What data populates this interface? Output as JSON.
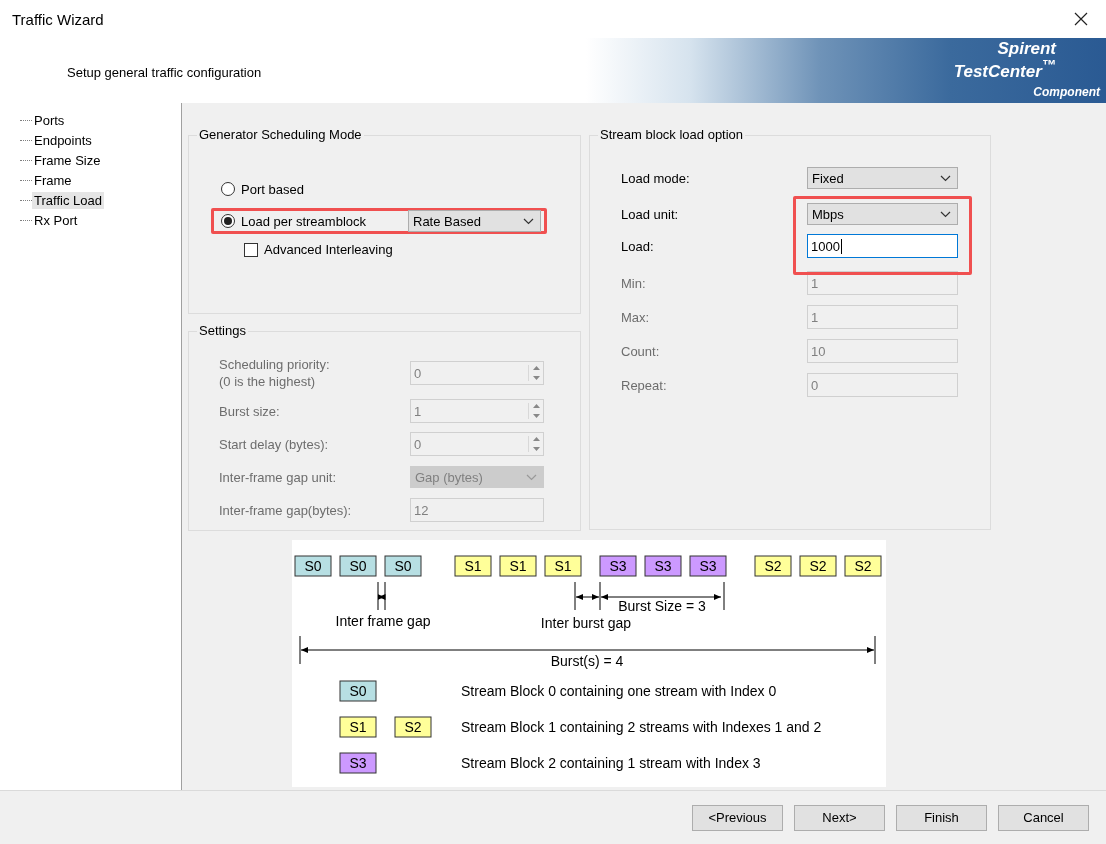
{
  "window": {
    "title": "Traffic Wizard"
  },
  "header": {
    "subtitle": "Setup general traffic configuration",
    "logo": {
      "line1": "Spirent",
      "line2": "TestCenter",
      "mark": "™",
      "tag": "Component"
    }
  },
  "sidebar": {
    "items": [
      {
        "label": "Ports",
        "selected": false
      },
      {
        "label": "Endpoints",
        "selected": false
      },
      {
        "label": "Frame Size",
        "selected": false
      },
      {
        "label": "Frame",
        "selected": false
      },
      {
        "label": "Traffic Load",
        "selected": true
      },
      {
        "label": "Rx Port",
        "selected": false
      }
    ]
  },
  "scheduling": {
    "title": "Generator Scheduling Mode",
    "options": [
      {
        "label": "Port based",
        "selected": false,
        "highlighted": false
      },
      {
        "label": "Load per streamblock",
        "selected": true,
        "highlighted": true,
        "dropdown": "Rate Based"
      }
    ],
    "checkbox": {
      "label": "Advanced Interleaving",
      "checked": false
    }
  },
  "settings": {
    "title": "Settings",
    "rows": [
      {
        "kind": "spinner",
        "label": "Scheduling priority:",
        "hint": "(0 is the highest)",
        "value": "0",
        "disabled": true
      },
      {
        "kind": "spinner",
        "label": "Burst size:",
        "value": "1",
        "disabled": true
      },
      {
        "kind": "spinner",
        "label": "Start delay (bytes):",
        "value": "0",
        "disabled": true
      },
      {
        "kind": "dropdown",
        "label": "Inter-frame gap unit:",
        "value": "Gap (bytes)",
        "disabled": true
      },
      {
        "kind": "input",
        "label": "Inter-frame gap(bytes):",
        "value": "12",
        "disabled": true
      }
    ]
  },
  "load_option": {
    "title": "Stream block load option",
    "rows": [
      {
        "kind": "dropdown",
        "label": "Load mode:",
        "value": "Fixed",
        "disabled": false,
        "highlighted": false
      },
      {
        "kind": "dropdown",
        "label": "Load unit:",
        "value": "Mbps",
        "disabled": false,
        "highlighted": true
      },
      {
        "kind": "input",
        "label": "Load:",
        "value": "1000",
        "disabled": false,
        "highlighted": true,
        "focused": true
      },
      {
        "kind": "input",
        "label": "Min:",
        "value": "1",
        "disabled": true,
        "highlighted": false
      },
      {
        "kind": "input",
        "label": "Max:",
        "value": "1",
        "disabled": true,
        "highlighted": false
      },
      {
        "kind": "input",
        "label": "Count:",
        "value": "10",
        "disabled": true,
        "highlighted": false
      },
      {
        "kind": "input",
        "label": "Repeat:",
        "value": "0",
        "disabled": true,
        "highlighted": false
      }
    ]
  },
  "diagram": {
    "frames": [
      {
        "label": "S0",
        "color": "#b7dfe3"
      },
      {
        "label": "S0",
        "color": "#b7dfe3"
      },
      {
        "label": "S0",
        "color": "#b7dfe3"
      },
      {
        "label": "S1",
        "color": "#ffff99"
      },
      {
        "label": "S1",
        "color": "#ffff99"
      },
      {
        "label": "S1",
        "color": "#ffff99"
      },
      {
        "label": "S3",
        "color": "#cc99ff"
      },
      {
        "label": "S3",
        "color": "#cc99ff"
      },
      {
        "label": "S3",
        "color": "#cc99ff"
      },
      {
        "label": "S2",
        "color": "#ffff99"
      },
      {
        "label": "S2",
        "color": "#ffff99"
      },
      {
        "label": "S2",
        "color": "#ffff99"
      }
    ],
    "inter_frame_gap": "Inter frame gap",
    "inter_burst_gap": "Inter burst gap",
    "burst_size": "Burst Size = 3",
    "bursts": "Burst(s) = 4",
    "legend": [
      {
        "boxes": [
          {
            "label": "S0",
            "color": "#b7dfe3"
          }
        ],
        "text": "Stream Block 0 containing one stream with Index 0"
      },
      {
        "boxes": [
          {
            "label": "S1",
            "color": "#ffff99"
          },
          {
            "label": "S2",
            "color": "#ffff99"
          }
        ],
        "text": "Stream Block 1 containing 2 streams with Indexes 1 and 2"
      },
      {
        "boxes": [
          {
            "label": "S3",
            "color": "#cc99ff"
          }
        ],
        "text": "Stream Block 2 containing 1 stream with Index 3"
      }
    ]
  },
  "buttons": [
    "<Previous",
    "Next>",
    "Finish",
    "Cancel"
  ]
}
